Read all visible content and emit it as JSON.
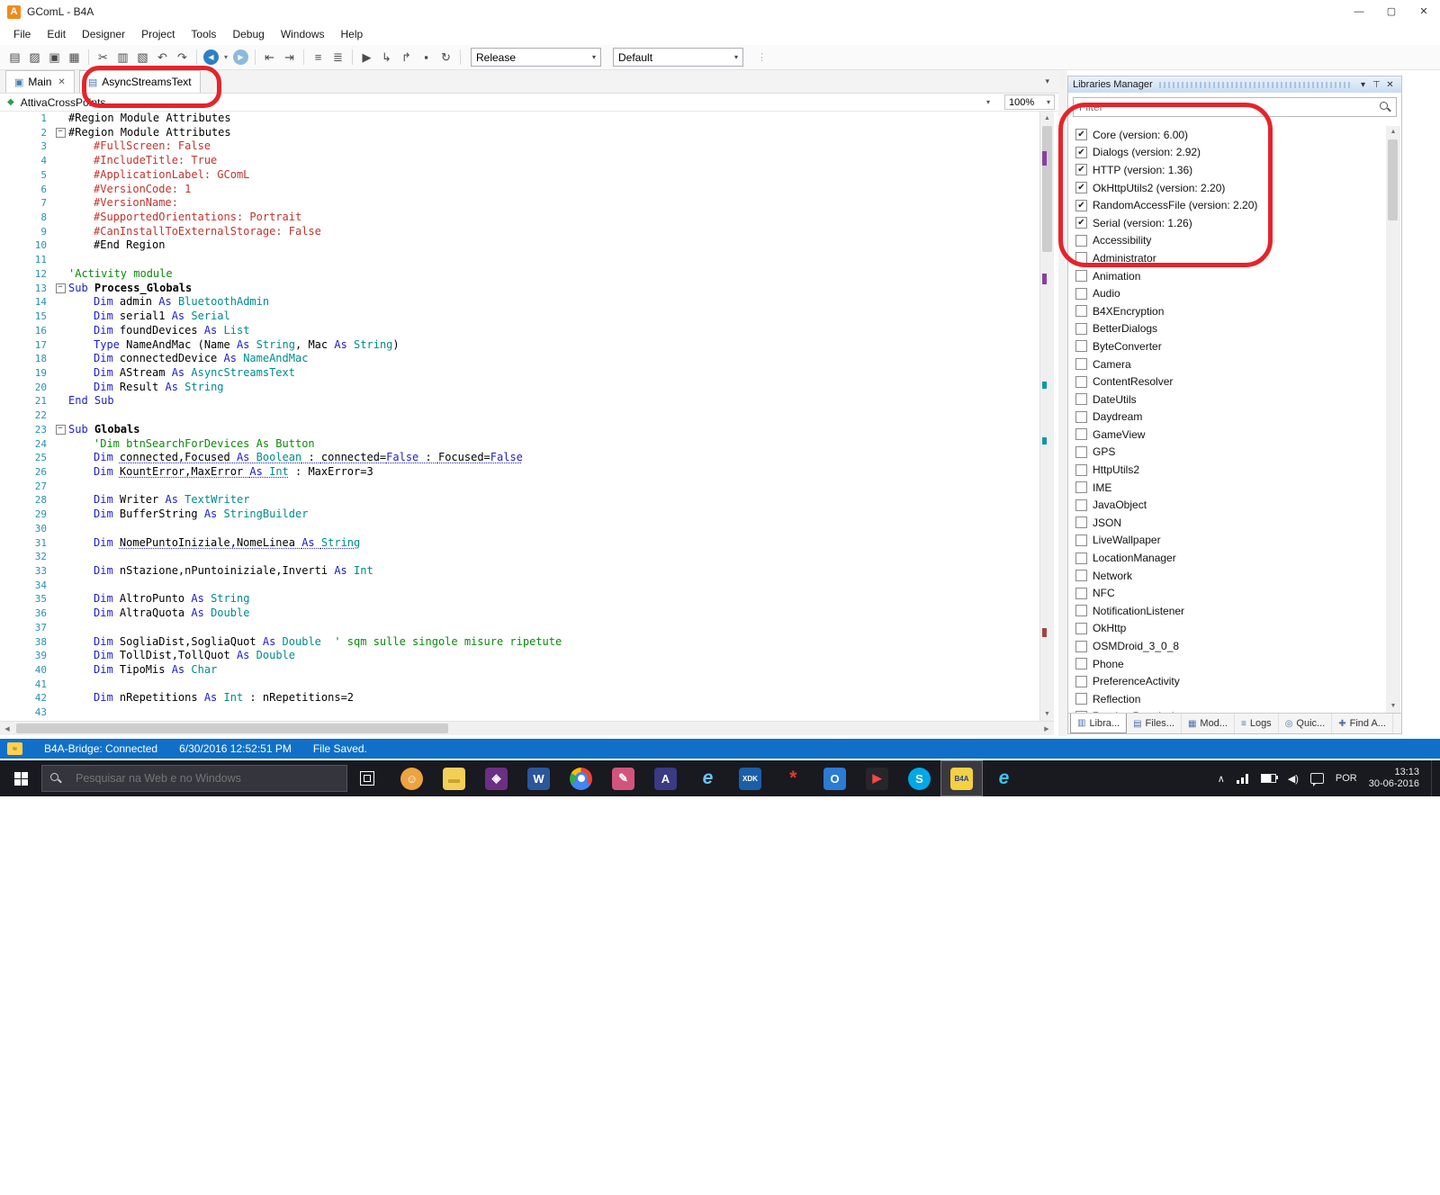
{
  "window": {
    "title": "GComL - B4A",
    "logo_letter": "A"
  },
  "icons": {
    "minimize": "—",
    "restore": "▢",
    "close": "✕",
    "tab_close": "✕",
    "caret": "▾",
    "pin": "⊤",
    "panel_close": "✕",
    "check": "✔",
    "scroll_up": "▲",
    "scroll_down": "▼",
    "scroll_left": "◀",
    "scroll_right": "▶",
    "main_tab": "▣",
    "module_tab": "▤",
    "nav_scope": "◆",
    "tray_expand": "∧",
    "volume": "◀)",
    "grip": "⋮"
  },
  "menu": {
    "items": [
      "File",
      "Edit",
      "Designer",
      "Project",
      "Tools",
      "Debug",
      "Windows",
      "Help"
    ]
  },
  "toolbar": {
    "release": "Release",
    "default": "Default",
    "icons": [
      {
        "name": "new-module-icon",
        "g": "▤"
      },
      {
        "name": "open-project-icon",
        "g": "▨"
      },
      {
        "name": "save-icon",
        "g": "▣"
      },
      {
        "name": "save-all-icon",
        "g": "▦"
      },
      {
        "sep": true
      },
      {
        "name": "cut-icon",
        "g": "✂"
      },
      {
        "name": "copy-icon",
        "g": "▥"
      },
      {
        "name": "paste-icon",
        "g": "▧"
      },
      {
        "name": "undo-icon",
        "g": "↶"
      },
      {
        "name": "redo-icon",
        "g": "↷"
      },
      {
        "sep": true
      },
      {
        "name": "navigate-back-icon",
        "g": "◀",
        "cls": "blue-circle"
      },
      {
        "name": "back-history-caret-icon",
        "g": "▾",
        "cls": "mini"
      },
      {
        "name": "navigate-forward-icon",
        "g": "▶",
        "cls": "blue-circle fwd"
      },
      {
        "sep": true
      },
      {
        "name": "outdent-icon",
        "g": "⇤"
      },
      {
        "name": "indent-icon",
        "g": "⇥"
      },
      {
        "sep": true
      },
      {
        "name": "comment-icon",
        "g": "≡"
      },
      {
        "name": "uncomment-icon",
        "g": "≣"
      },
      {
        "sep": true
      },
      {
        "name": "run-icon",
        "g": "▶"
      },
      {
        "name": "step-into-icon",
        "g": "↳"
      },
      {
        "name": "step-over-icon",
        "g": "↱"
      },
      {
        "name": "breakpoint-icon",
        "g": "▪"
      },
      {
        "name": "clean-project-icon",
        "g": "↻"
      },
      {
        "sep": true
      }
    ]
  },
  "tabs": {
    "main": "Main",
    "module": "AsyncStreamsText"
  },
  "nav": {
    "scope": "AttivaCrossPoints",
    "zoom": "100%"
  },
  "editor": {
    "lines": [
      {
        "n": 1,
        "i": 0,
        "s": [
          [
            "#Region Module Attributes",
            "p"
          ]
        ]
      },
      {
        "n": 2,
        "f": "−",
        "i": 0,
        "s": [
          [
            "#Region Module Attributes",
            "p"
          ]
        ]
      },
      {
        "n": 3,
        "i": 1,
        "s": [
          [
            "#FullScreen: False",
            "a"
          ]
        ]
      },
      {
        "n": 4,
        "i": 1,
        "s": [
          [
            "#IncludeTitle: True",
            "a"
          ]
        ]
      },
      {
        "n": 5,
        "i": 1,
        "s": [
          [
            "#ApplicationLabel: GComL",
            "a"
          ]
        ]
      },
      {
        "n": 6,
        "i": 1,
        "s": [
          [
            "#VersionCode: 1",
            "a"
          ]
        ]
      },
      {
        "n": 7,
        "i": 1,
        "s": [
          [
            "#VersionName: ",
            "a"
          ]
        ]
      },
      {
        "n": 8,
        "i": 1,
        "s": [
          [
            "#SupportedOrientations: Portrait",
            "a"
          ]
        ]
      },
      {
        "n": 9,
        "i": 1,
        "s": [
          [
            "#CanInstallToExternalStorage: False",
            "a"
          ]
        ]
      },
      {
        "n": 10,
        "i": 1,
        "s": [
          [
            "#End Region",
            "p"
          ]
        ]
      },
      {
        "n": 11,
        "i": 0,
        "s": []
      },
      {
        "n": 12,
        "i": 0,
        "s": [
          [
            "'Activity module",
            "c"
          ]
        ]
      },
      {
        "n": 13,
        "f": "−",
        "i": 0,
        "s": [
          [
            "Sub ",
            "k"
          ],
          [
            "Process_Globals",
            "b"
          ]
        ]
      },
      {
        "n": 14,
        "i": 1,
        "s": [
          [
            "Dim ",
            "k"
          ],
          [
            "admin ",
            "p"
          ],
          [
            "As ",
            "k"
          ],
          [
            "BluetoothAdmin",
            "t"
          ]
        ]
      },
      {
        "n": 15,
        "i": 1,
        "s": [
          [
            "Dim ",
            "k"
          ],
          [
            "serial1 ",
            "p"
          ],
          [
            "As ",
            "k"
          ],
          [
            "Serial",
            "t"
          ]
        ]
      },
      {
        "n": 16,
        "i": 1,
        "s": [
          [
            "Dim ",
            "k"
          ],
          [
            "foundDevices ",
            "p"
          ],
          [
            "As ",
            "k"
          ],
          [
            "List",
            "t"
          ]
        ]
      },
      {
        "n": 17,
        "i": 1,
        "s": [
          [
            "Type ",
            "k"
          ],
          [
            "NameAndMac (Name ",
            "p"
          ],
          [
            "As ",
            "k"
          ],
          [
            "String",
            "t"
          ],
          [
            ", Mac ",
            "p"
          ],
          [
            "As ",
            "k"
          ],
          [
            "String",
            "t"
          ],
          [
            ")",
            "p"
          ]
        ]
      },
      {
        "n": 18,
        "i": 1,
        "s": [
          [
            "Dim ",
            "k"
          ],
          [
            "connectedDevice ",
            "p"
          ],
          [
            "As ",
            "k"
          ],
          [
            "NameAndMac",
            "t"
          ]
        ]
      },
      {
        "n": 19,
        "i": 1,
        "s": [
          [
            "Dim ",
            "k"
          ],
          [
            "AStream ",
            "p"
          ],
          [
            "As ",
            "k"
          ],
          [
            "AsyncStreamsText",
            "t"
          ]
        ]
      },
      {
        "n": 20,
        "i": 1,
        "s": [
          [
            "Dim ",
            "k"
          ],
          [
            "Result ",
            "p"
          ],
          [
            "As ",
            "k"
          ],
          [
            "String",
            "t"
          ]
        ]
      },
      {
        "n": 21,
        "i": 0,
        "s": [
          [
            "End Sub",
            "k"
          ]
        ]
      },
      {
        "n": 22,
        "i": 0,
        "s": []
      },
      {
        "n": 23,
        "f": "−",
        "i": 0,
        "s": [
          [
            "Sub ",
            "k"
          ],
          [
            "Globals",
            "b"
          ]
        ]
      },
      {
        "n": 24,
        "i": 1,
        "s": [
          [
            "'Dim btnSearchForDevices As Button",
            "c"
          ]
        ]
      },
      {
        "n": 25,
        "i": 1,
        "s": [
          [
            "Dim ",
            "k"
          ],
          [
            "connected,Focused ",
            "p u"
          ],
          [
            "As ",
            "k u"
          ],
          [
            "Boolean",
            "t u"
          ],
          [
            " : ",
            "p u"
          ],
          [
            "connected=",
            "p u"
          ],
          [
            "False",
            "k u"
          ],
          [
            " : ",
            "p u"
          ],
          [
            "Focused=",
            "p u"
          ],
          [
            "False",
            "k u"
          ]
        ]
      },
      {
        "n": 26,
        "i": 1,
        "s": [
          [
            "Dim ",
            "k"
          ],
          [
            "KountError,MaxError ",
            "p u"
          ],
          [
            "As ",
            "k u"
          ],
          [
            "Int",
            "t u"
          ],
          [
            " : MaxError=3",
            "p"
          ]
        ]
      },
      {
        "n": 27,
        "i": 0,
        "s": []
      },
      {
        "n": 28,
        "i": 1,
        "s": [
          [
            "Dim ",
            "k"
          ],
          [
            "Writer ",
            "p"
          ],
          [
            "As ",
            "k"
          ],
          [
            "TextWriter",
            "t"
          ]
        ]
      },
      {
        "n": 29,
        "i": 1,
        "s": [
          [
            "Dim ",
            "k"
          ],
          [
            "BufferString ",
            "p"
          ],
          [
            "As ",
            "k"
          ],
          [
            "StringBuilder",
            "t"
          ]
        ]
      },
      {
        "n": 30,
        "i": 0,
        "s": []
      },
      {
        "n": 31,
        "i": 1,
        "s": [
          [
            "Dim ",
            "k"
          ],
          [
            "NomePuntoIniziale,NomeLinea ",
            "p u"
          ],
          [
            "As ",
            "k u"
          ],
          [
            "String",
            "t u"
          ]
        ]
      },
      {
        "n": 32,
        "i": 0,
        "s": []
      },
      {
        "n": 33,
        "i": 1,
        "s": [
          [
            "Dim ",
            "k"
          ],
          [
            "nStazione,nPuntoiniziale,Inverti ",
            "p"
          ],
          [
            "As ",
            "k"
          ],
          [
            "Int",
            "t"
          ]
        ]
      },
      {
        "n": 34,
        "i": 0,
        "s": []
      },
      {
        "n": 35,
        "i": 1,
        "s": [
          [
            "Dim ",
            "k"
          ],
          [
            "AltroPunto ",
            "p"
          ],
          [
            "As ",
            "k"
          ],
          [
            "String",
            "t"
          ]
        ]
      },
      {
        "n": 36,
        "i": 1,
        "s": [
          [
            "Dim ",
            "k"
          ],
          [
            "AltraQuota ",
            "p"
          ],
          [
            "As ",
            "k"
          ],
          [
            "Double",
            "t"
          ]
        ]
      },
      {
        "n": 37,
        "i": 0,
        "s": []
      },
      {
        "n": 38,
        "i": 1,
        "s": [
          [
            "Dim ",
            "k"
          ],
          [
            "SogliaDist,SogliaQuot ",
            "p"
          ],
          [
            "As ",
            "k"
          ],
          [
            "Double",
            "t"
          ],
          [
            "  ",
            "p"
          ],
          [
            "' sqm sulle singole misure ripetute",
            "c"
          ]
        ]
      },
      {
        "n": 39,
        "i": 1,
        "s": [
          [
            "Dim ",
            "k"
          ],
          [
            "TollDist,TollQuot ",
            "p"
          ],
          [
            "As ",
            "k"
          ],
          [
            "Double",
            "t"
          ]
        ]
      },
      {
        "n": 40,
        "i": 1,
        "s": [
          [
            "Dim ",
            "k"
          ],
          [
            "TipoMis ",
            "p"
          ],
          [
            "As ",
            "k"
          ],
          [
            "Char",
            "t"
          ]
        ]
      },
      {
        "n": 41,
        "i": 0,
        "s": []
      },
      {
        "n": 42,
        "i": 1,
        "s": [
          [
            "Dim ",
            "k"
          ],
          [
            "nRepetitions ",
            "p"
          ],
          [
            "As ",
            "k"
          ],
          [
            "Int",
            "t"
          ],
          [
            " : nRepetitions=2",
            "p"
          ]
        ]
      },
      {
        "n": 43,
        "i": 0,
        "s": []
      }
    ]
  },
  "libraries_panel": {
    "title": "Libraries Manager",
    "filter_placeholder": "Filter",
    "items": [
      {
        "label": "Core (version: 6.00)",
        "checked": true
      },
      {
        "label": "Dialogs (version: 2.92)",
        "checked": true
      },
      {
        "label": "HTTP (version: 1.36)",
        "checked": true
      },
      {
        "label": "OkHttpUtils2 (version: 2.20)",
        "checked": true
      },
      {
        "label": "RandomAccessFile (version: 2.20)",
        "checked": true
      },
      {
        "label": "Serial (version: 1.26)",
        "checked": true
      },
      {
        "label": "Accessibility",
        "checked": false
      },
      {
        "label": "Administrator",
        "checked": false
      },
      {
        "label": "Animation",
        "checked": false
      },
      {
        "label": "Audio",
        "checked": false
      },
      {
        "label": "B4XEncryption",
        "checked": false
      },
      {
        "label": "BetterDialogs",
        "checked": false
      },
      {
        "label": "ByteConverter",
        "checked": false
      },
      {
        "label": "Camera",
        "checked": false
      },
      {
        "label": "ContentResolver",
        "checked": false
      },
      {
        "label": "DateUtils",
        "checked": false
      },
      {
        "label": "Daydream",
        "checked": false
      },
      {
        "label": "GameView",
        "checked": false
      },
      {
        "label": "GPS",
        "checked": false
      },
      {
        "label": "HttpUtils2",
        "checked": false
      },
      {
        "label": "IME",
        "checked": false
      },
      {
        "label": "JavaObject",
        "checked": false
      },
      {
        "label": "JSON",
        "checked": false
      },
      {
        "label": "LiveWallpaper",
        "checked": false
      },
      {
        "label": "LocationManager",
        "checked": false
      },
      {
        "label": "Network",
        "checked": false
      },
      {
        "label": "NFC",
        "checked": false
      },
      {
        "label": "NotificationListener",
        "checked": false
      },
      {
        "label": "OkHttp",
        "checked": false
      },
      {
        "label": "OSMDroid_3_0_8",
        "checked": false
      },
      {
        "label": "Phone",
        "checked": false
      },
      {
        "label": "PreferenceActivity",
        "checked": false
      },
      {
        "label": "Reflection",
        "checked": false
      },
      {
        "label": "RuntimePermissions",
        "checked": false
      }
    ],
    "bottom_tabs": [
      {
        "label": "Libra...",
        "icon": "▥"
      },
      {
        "label": "Files...",
        "icon": "▤"
      },
      {
        "label": "Mod...",
        "icon": "▦"
      },
      {
        "label": "Logs",
        "icon": "≡"
      },
      {
        "label": "Quic...",
        "icon": "◎"
      },
      {
        "label": "Find A...",
        "icon": "✚"
      }
    ]
  },
  "status_bar": {
    "bridge": "B4A-Bridge: Connected",
    "timestamp": "6/30/2016 12:52:51 PM",
    "saved": "File Saved."
  },
  "taskbar": {
    "search_placeholder": "Pesquisar na Web e no Windows",
    "lang": "POR",
    "time": "13:13",
    "date": "30-06-2016",
    "apps": [
      {
        "name": "chat-app-icon",
        "glyph": "☺",
        "bg": "#eda33f",
        "fg": "#fff",
        "round": true
      },
      {
        "name": "file-explorer-icon",
        "glyph": "▬",
        "bg": "#f3cf57",
        "fg": "#c8a136"
      },
      {
        "name": "media-app-icon",
        "glyph": "◈",
        "bg": "#6c2f84",
        "fg": "#fff"
      },
      {
        "name": "word-icon",
        "glyph": "W",
        "bg": "#2b579a",
        "fg": "#fff"
      },
      {
        "name": "chrome-icon",
        "glyph": "",
        "chrome": true
      },
      {
        "name": "paint-app-icon",
        "glyph": "✎",
        "bg": "#d2547c",
        "fg": "#fff"
      },
      {
        "name": "reader-app-icon",
        "glyph": "A",
        "bg": "#3a3a85",
        "fg": "#fff"
      },
      {
        "name": "ie-icon",
        "glyph": "e",
        "fg": "#6cc3f0",
        "big": true
      },
      {
        "name": "intel-xdk-icon",
        "glyph": "XDK",
        "bg": "#1b5fa8",
        "fg": "#fff",
        "small": true
      },
      {
        "name": "star-app-icon",
        "glyph": "*",
        "fg": "#e23b2e",
        "big": true
      },
      {
        "name": "outlook-icon",
        "glyph": "O",
        "bg": "#2a7cd4",
        "fg": "#fff"
      },
      {
        "name": "video-app-icon",
        "glyph": "▶",
        "bg": "#26262c",
        "fg": "#ff4545"
      },
      {
        "name": "skype-icon",
        "glyph": "S",
        "bg": "#00a8e8",
        "fg": "#fff",
        "round": true
      },
      {
        "name": "b4a-icon",
        "glyph": "B4A",
        "bg": "#f5d042",
        "fg": "#27408b",
        "small": true,
        "active": true
      },
      {
        "name": "edge-icon",
        "glyph": "e",
        "fg": "#3fc1f2",
        "big": true
      }
    ]
  },
  "colors": {
    "annotation": "#e5242b",
    "status_bar": "#1070c9",
    "keyword": "#2020cc",
    "type": "#008b8b",
    "comment": "#0a8a0a",
    "attribute": "#c2342c"
  }
}
